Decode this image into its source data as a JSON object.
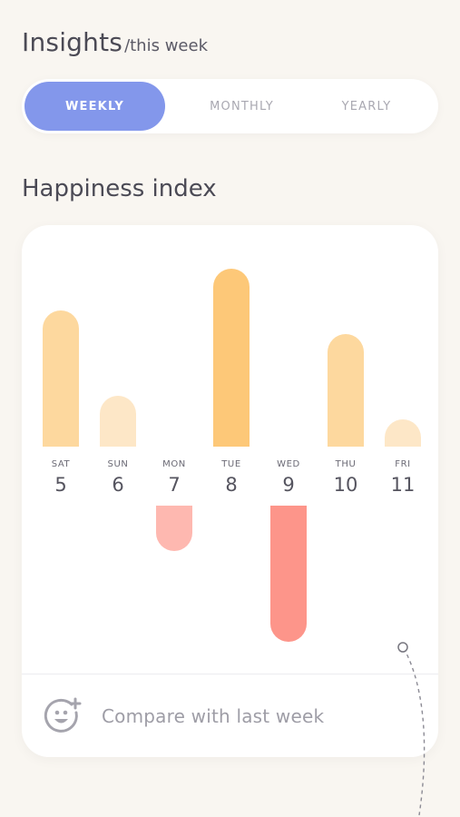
{
  "header": {
    "title": "Insights",
    "subtitle": "/this week"
  },
  "tabs": [
    {
      "label": "WEEKLY",
      "active": true
    },
    {
      "label": "MONTHLY",
      "active": false
    },
    {
      "label": "YEARLY",
      "active": false
    }
  ],
  "section_title": "Happiness index",
  "compare_label": "Compare with last week",
  "colors": {
    "accent": "#8397eb",
    "positive_strong": "#fdc878",
    "positive_mid": "#fdd89e",
    "positive_light": "#fde7c7",
    "negative_light": "#feb8b0",
    "negative_strong": "#fd958a"
  },
  "chart_data": {
    "type": "bar",
    "categories": [
      "SAT",
      "SUN",
      "MON",
      "TUE",
      "WED",
      "THU",
      "FRI"
    ],
    "dates": [
      "5",
      "6",
      "7",
      "8",
      "9",
      "10",
      "11"
    ],
    "values": [
      7.5,
      2.8,
      -2.5,
      9.8,
      -7.5,
      6.2,
      1.5
    ],
    "ylim": [
      -10,
      10
    ]
  }
}
